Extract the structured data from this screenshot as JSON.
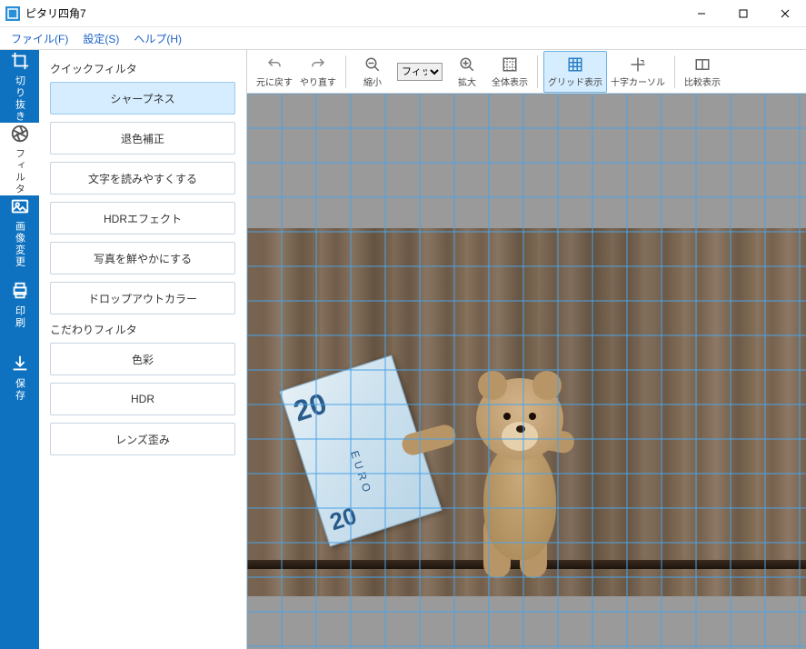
{
  "window": {
    "title": "ピタリ四角7",
    "controls": {
      "min": "—",
      "max": "☐",
      "close": "✕"
    }
  },
  "menubar": {
    "file": "ファイル(F)",
    "settings": "設定(S)",
    "help": "ヘルプ(H)"
  },
  "rail": {
    "crop": "切り抜き",
    "filter": "フィルタ",
    "image_change": "画像変更",
    "print": "印刷",
    "save": "保存"
  },
  "sidepanel": {
    "quick_title": "クイックフィルタ",
    "quick": {
      "sharpness": "シャープネス",
      "fade_correction": "退色補正",
      "text_readable": "文字を読みやすくする",
      "hdr_effect": "HDRエフェクト",
      "vivid": "写真を鮮やかにする",
      "dropout": "ドロップアウトカラー"
    },
    "detail_title": "こだわりフィルタ",
    "detail": {
      "color": "色彩",
      "hdr": "HDR",
      "lens": "レンズ歪み"
    }
  },
  "toolbar": {
    "undo": "元に戻す",
    "redo": "やり直す",
    "zoom_out": "縮小",
    "fit_value": "フィット",
    "zoom_in": "拡大",
    "fit_all": "全体表示",
    "grid": "グリッド表示",
    "cross": "十字カーソル",
    "compare": "比較表示"
  },
  "image": {
    "banknote_value": "20",
    "banknote_currency": "EURO"
  }
}
